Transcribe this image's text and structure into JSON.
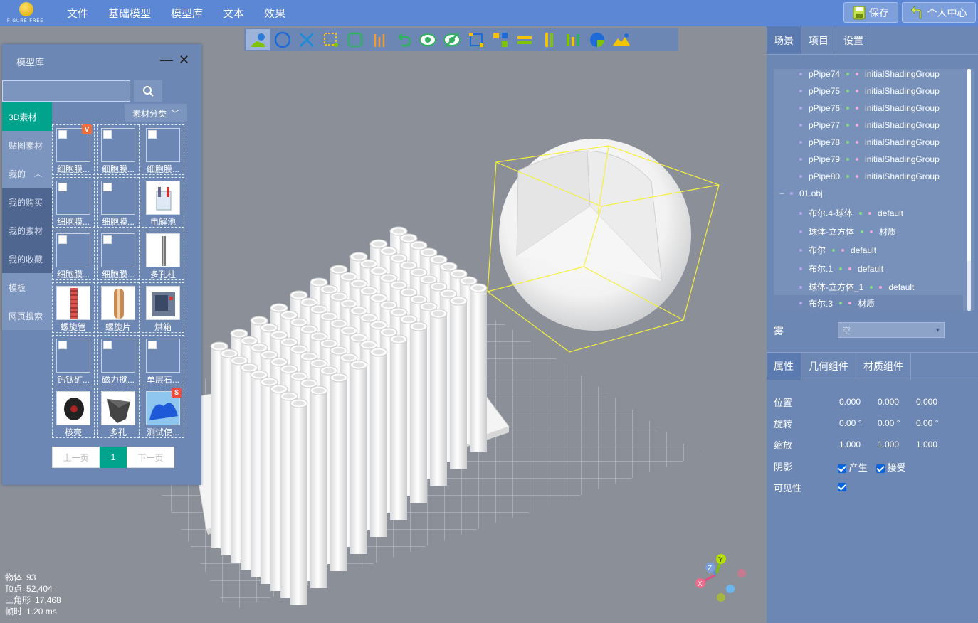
{
  "logo_text": "FIGURE FREE",
  "menu": [
    "文件",
    "基础模型",
    "模型库",
    "文本",
    "效果"
  ],
  "top_buttons": {
    "save": "保存",
    "user_center": "个人中心"
  },
  "library": {
    "title": "模型库",
    "search_placeholder": "",
    "category_button": "素材分类",
    "sidebar": [
      "3D素材",
      "贴图素材",
      "我的",
      "我的购买",
      "我的素材",
      "我的收藏",
      "模板",
      "网页搜索"
    ],
    "items": [
      {
        "label": "细胞膜...",
        "badge": "V"
      },
      {
        "label": "细胞膜...",
        "badge": ""
      },
      {
        "label": "细胞膜...",
        "badge": ""
      },
      {
        "label": "细胞膜...",
        "badge": ""
      },
      {
        "label": "细胞膜...",
        "badge": ""
      },
      {
        "label": "电解池",
        "badge": ""
      },
      {
        "label": "细胞膜...",
        "badge": ""
      },
      {
        "label": "细胞膜...",
        "badge": ""
      },
      {
        "label": "多孔柱",
        "badge": ""
      },
      {
        "label": "螺旋管",
        "badge": ""
      },
      {
        "label": "螺旋片",
        "badge": ""
      },
      {
        "label": "烘箱",
        "badge": ""
      },
      {
        "label": "钙钛矿...",
        "badge": ""
      },
      {
        "label": "磁力搅...",
        "badge": ""
      },
      {
        "label": "单层石...",
        "badge": ""
      },
      {
        "label": "核壳",
        "badge": ""
      },
      {
        "label": "多孔",
        "badge": ""
      },
      {
        "label": "测试使...",
        "badge": "$"
      }
    ],
    "pager": {
      "prev": "上一页",
      "current": "1",
      "next": "下一页"
    }
  },
  "stats": {
    "objects_label": "物体",
    "objects": "93",
    "vertices_label": "顶点",
    "vertices": "52,404",
    "triangles_label": "三角形",
    "triangles": "17,468",
    "frame_label": "帧时",
    "frame": "1.20 ms"
  },
  "right_panel": {
    "tabs": [
      "场景",
      "项目",
      "设置"
    ],
    "tree": [
      {
        "name": "pPipe74",
        "material": "initialShadingGroup"
      },
      {
        "name": "pPipe75",
        "material": "initialShadingGroup"
      },
      {
        "name": "pPipe76",
        "material": "initialShadingGroup"
      },
      {
        "name": "pPipe77",
        "material": "initialShadingGroup"
      },
      {
        "name": "pPipe78",
        "material": "initialShadingGroup"
      },
      {
        "name": "pPipe79",
        "material": "initialShadingGroup"
      },
      {
        "name": "pPipe80",
        "material": "initialShadingGroup"
      },
      {
        "name": "01.obj",
        "material": ""
      },
      {
        "name": "布尔.4-球体",
        "material": "default"
      },
      {
        "name": "球体-立方体",
        "material": "材质"
      },
      {
        "name": "布尔",
        "material": "default"
      },
      {
        "name": "布尔.1",
        "material": "default"
      },
      {
        "name": "球体-立方体_1",
        "material": "default"
      },
      {
        "name": "布尔.3",
        "material": "材质"
      }
    ],
    "tree_collapse": "−",
    "fog_label": "雾",
    "fog_value": "空",
    "prop_tabs": [
      "属性",
      "几何组件",
      "材质组件"
    ],
    "props": {
      "position_label": "位置",
      "position": [
        "0.000",
        "0.000",
        "0.000"
      ],
      "rotation_label": "旋转",
      "rotation": [
        "0.00 °",
        "0.00 °",
        "0.00 °"
      ],
      "scale_label": "缩放",
      "scale": [
        "1.000",
        "1.000",
        "1.000"
      ],
      "shadow_label": "阴影",
      "shadow_cast": "产生",
      "shadow_receive": "接受",
      "visible_label": "可见性"
    }
  },
  "axis_labels": {
    "x": "X",
    "y": "Y",
    "z": "Z"
  }
}
